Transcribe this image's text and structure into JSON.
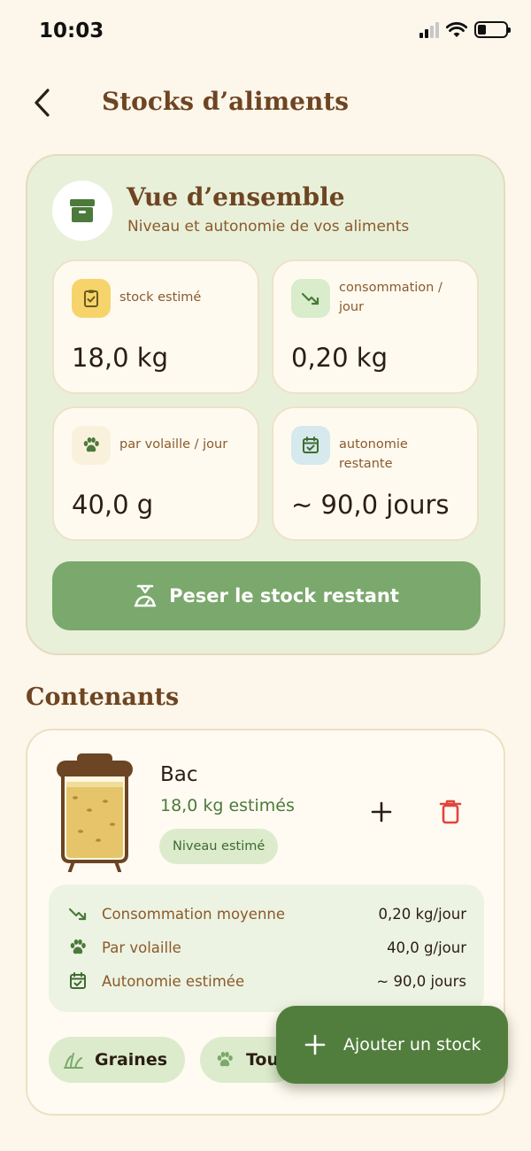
{
  "status": {
    "time": "10:03"
  },
  "header": {
    "title": "Stocks d’aliments"
  },
  "overview": {
    "title": "Vue d’ensemble",
    "subtitle": "Niveau et autonomie de vos aliments",
    "stats": [
      {
        "label": "stock estimé",
        "value": "18,0 kg",
        "icon": "clipboard-check-icon",
        "color": "#f7d46b"
      },
      {
        "label": "consommation / jour",
        "value": "0,20 kg",
        "icon": "trending-down-icon",
        "color": "#d9eccb"
      },
      {
        "label": "par volaille / jour",
        "value": "40,0 g",
        "icon": "paw-icon",
        "color": "#faf1dd"
      },
      {
        "label": "autonomie restante",
        "value": "~ 90,0 jours",
        "icon": "calendar-check-icon",
        "color": "#d6e9ec"
      }
    ],
    "weigh_button": "Peser le stock restant"
  },
  "containers_section": {
    "title": "Contenants"
  },
  "container": {
    "name": "Bac",
    "amount": "18,0 kg estimés",
    "badge": "Niveau estimé",
    "fill_level": 0.85,
    "metrics": [
      {
        "label": "Consommation moyenne",
        "value": "0,20 kg/jour",
        "icon": "trending-down-icon"
      },
      {
        "label": "Par volaille",
        "value": "40,0 g/jour",
        "icon": "paw-icon"
      },
      {
        "label": "Autonomie estimée",
        "value": "~ 90,0 jours",
        "icon": "calendar-check-icon"
      }
    ],
    "chips": [
      {
        "label": "Graines",
        "icon": "grass-icon"
      },
      {
        "label": "Tou",
        "icon": "paw-icon"
      }
    ]
  },
  "fab": {
    "label": "Ajouter un stock"
  },
  "colors": {
    "accent": "#7ba86c",
    "primary_dark": "#527e3d",
    "title_brown": "#6e4522",
    "danger": "#e2453c"
  }
}
